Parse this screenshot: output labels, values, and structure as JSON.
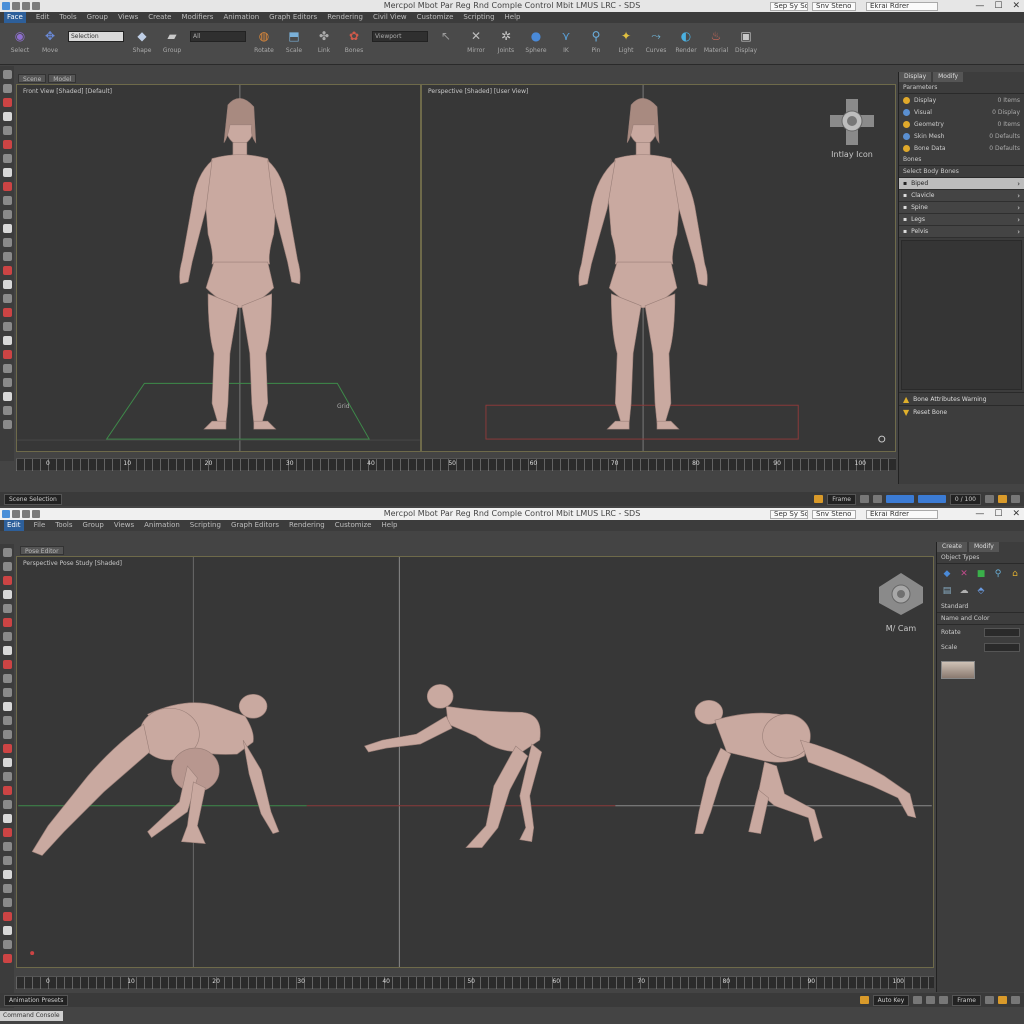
{
  "window1": {
    "title": "Mercpol Mbot Par Reg Rnd Comple Control Mbit LMUS LRC - SDS",
    "title_fields": [
      "Sep Sy Sqrad",
      "Snv Steno",
      "Ekrai Rdrer"
    ],
    "window_controls": [
      "—",
      "☐",
      "✕"
    ],
    "menu": [
      "Face",
      "Edit",
      "Tools",
      "Group",
      "Views",
      "Create",
      "Modifiers",
      "Animation",
      "Graph Editors",
      "Rendering",
      "Civil View",
      "Customize",
      "Scripting",
      "Help"
    ],
    "toolbar": {
      "tools": [
        {
          "icon": "select-icon",
          "label": "Select",
          "color": "#8e6fd0",
          "glyph": "◉"
        },
        {
          "icon": "move-icon",
          "label": "Move",
          "color": "#6a8ad8",
          "glyph": "✥"
        },
        {
          "icon": "cube-icon",
          "label": "Shape",
          "color": "#bfcfe6",
          "glyph": "◆"
        },
        {
          "icon": "box-icon",
          "label": "Group",
          "color": "#c9c9c9",
          "glyph": "▰"
        },
        {
          "icon": "rotate-icon",
          "label": "Rotate",
          "color": "#e08a3a",
          "glyph": "◍"
        },
        {
          "icon": "scale-icon",
          "label": "Scale",
          "color": "#7ab0d8",
          "glyph": "⬒"
        },
        {
          "icon": "link-icon",
          "label": "Link",
          "color": "#aaaaaa",
          "glyph": "✤"
        },
        {
          "icon": "bone-icon",
          "label": "Bones",
          "color": "#d05a4a",
          "glyph": "✿"
        },
        {
          "icon": "cursor-icon",
          "label": "",
          "color": "#9a9a9a",
          "glyph": "↖"
        },
        {
          "icon": "cross-icon",
          "label": "Mirror",
          "color": "#bdbdbd",
          "glyph": "✕"
        },
        {
          "icon": "joint-icon",
          "label": "Joints",
          "color": "#c8c8c8",
          "glyph": "✲"
        },
        {
          "icon": "sphere-icon",
          "label": "Sphere",
          "color": "#4a8ad8",
          "glyph": "●"
        },
        {
          "icon": "ik-icon",
          "label": "IK",
          "color": "#5aa0d8",
          "glyph": "⋎"
        },
        {
          "icon": "pin-icon",
          "label": "Pin",
          "color": "#6ab0e0",
          "glyph": "⚲"
        },
        {
          "icon": "bulb-icon",
          "label": "Light",
          "color": "#e0c040",
          "glyph": "✦"
        },
        {
          "icon": "graph-icon",
          "label": "Curves",
          "color": "#70b0d0",
          "glyph": "⤳"
        },
        {
          "icon": "render-icon",
          "label": "Render",
          "color": "#4ab0e0",
          "glyph": "◐"
        },
        {
          "icon": "teapot-icon",
          "label": "Material",
          "color": "#d06a5a",
          "glyph": "♨"
        },
        {
          "icon": "camera-icon",
          "label": "Display",
          "color": "#c8c8c8",
          "glyph": "▣"
        }
      ],
      "fields": [
        "Selection",
        "All",
        "Viewport",
        ""
      ]
    },
    "subtabs": [
      "Scene",
      "Model"
    ],
    "viewport_left": {
      "label": "Front View [Shaded] [Default]"
    },
    "viewport_right": {
      "label": "Perspective [Shaded] [User View]"
    },
    "grid_label": "Grid",
    "navcube_label": "Intlay Icon",
    "timeline_ticks": [
      "0",
      "10",
      "20",
      "30",
      "40",
      "50",
      "60",
      "70",
      "80",
      "90",
      "100"
    ],
    "status": {
      "left": "Scene Selection",
      "frame": "Frame",
      "field": "0 / 100"
    },
    "panel": {
      "tabs": [
        "Display",
        "Modify"
      ],
      "section1": "Parameters",
      "rows": [
        {
          "label": "Display",
          "value": "0 Items"
        },
        {
          "label": "Visual",
          "value": "0 Display"
        },
        {
          "label": "Geometry",
          "value": "0 Items"
        },
        {
          "label": "Skin Mesh",
          "value": "0 Defaults"
        },
        {
          "label": "Bone Data",
          "value": "0 Defaults"
        }
      ],
      "section2": "Bones",
      "subhead": "Select Body Bones",
      "items": [
        {
          "label": "Biped",
          "selected": true
        },
        {
          "label": "Clavicle",
          "selected": false
        },
        {
          "label": "Spine",
          "selected": false
        },
        {
          "label": "Legs",
          "selected": false
        },
        {
          "label": "Pelvis",
          "selected": false
        }
      ],
      "bottom1": "Bone Attributes Warning",
      "bottom2": "Reset Bone"
    }
  },
  "window2": {
    "title": "Mercpol Mbot Par Reg Rnd Comple Control Mbit LMUS LRC - SDS",
    "title_fields": [
      "Sep Sy Sqrad",
      "Snv Steno",
      "Ekrai Rdrer"
    ],
    "window_controls": [
      "—",
      "☐",
      "✕"
    ],
    "menu": [
      "Edit",
      "File",
      "Tools",
      "Group",
      "Views",
      "Animation",
      "Scripting",
      "Graph Editors",
      "Rendering",
      "Customize",
      "Help"
    ],
    "subtabs": [
      "Pose Editor"
    ],
    "viewport": {
      "label": "Perspective Pose Study [Shaded]"
    },
    "navcube_label": "M/ Cam",
    "timeline_ticks": [
      "0",
      "10",
      "20",
      "30",
      "40",
      "50",
      "60",
      "70",
      "80",
      "90",
      "100"
    ],
    "status": {
      "left": "Animation Presets",
      "frame": "Auto Key",
      "field": "Frame"
    },
    "panel": {
      "tabs": [
        "Create",
        "Modify"
      ],
      "section1": "Object Types",
      "icons": [
        {
          "icon": "sphere-icon",
          "color": "#4a8ad8",
          "glyph": "◆"
        },
        {
          "icon": "shape-icon",
          "color": "#c04a8a",
          "glyph": "✕"
        },
        {
          "icon": "box-icon",
          "color": "#3ab04a",
          "glyph": "■"
        },
        {
          "icon": "light-icon",
          "color": "#6ab0d8",
          "glyph": "⚲"
        },
        {
          "icon": "home-icon",
          "color": "#e0b030",
          "glyph": "⌂"
        },
        {
          "icon": "panel-icon",
          "color": "#8ab0c8",
          "glyph": "▤"
        },
        {
          "icon": "cloud-icon",
          "color": "#b0b0b0",
          "glyph": "☁"
        },
        {
          "icon": "system-icon",
          "color": "#6a9ae0",
          "glyph": "⬘"
        }
      ],
      "icons_caption": "Standard",
      "section2": "Name and Color",
      "field_label": "Rotate",
      "field_label2": "Scale"
    },
    "bottom_tab": "Command Console"
  }
}
